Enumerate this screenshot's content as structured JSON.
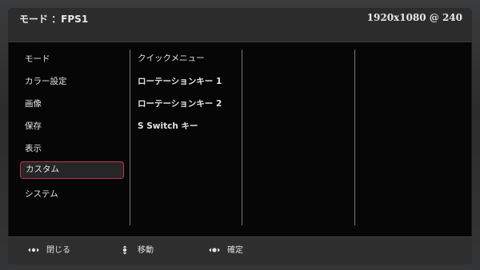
{
  "header": {
    "mode_label": "モード ：FPS1",
    "resolution": "1920x1080 @ 240"
  },
  "menu": {
    "items": [
      {
        "label": "モード"
      },
      {
        "label": "カラー設定"
      },
      {
        "label": "画像"
      },
      {
        "label": "保存"
      },
      {
        "label": "表示"
      },
      {
        "label": "カスタム",
        "selected": true
      },
      {
        "label": "システム"
      }
    ]
  },
  "submenu": {
    "items": [
      {
        "label": "クイックメニュー"
      },
      {
        "label": "ローテーションキー 1"
      },
      {
        "label": "ローテーションキー 2"
      },
      {
        "label": "S Switch キー"
      }
    ]
  },
  "footer": {
    "close_label": "閉じる",
    "move_label": "移動",
    "confirm_label": "確定",
    "close_icon": "dpad-left-right-icon",
    "move_icon": "dpad-up-down-icon",
    "confirm_icon": "dpad-press-icon"
  },
  "colors": {
    "selection_border": "#c0354a",
    "text": "#e4e4e4",
    "header_bg": "#2c2c2c"
  }
}
